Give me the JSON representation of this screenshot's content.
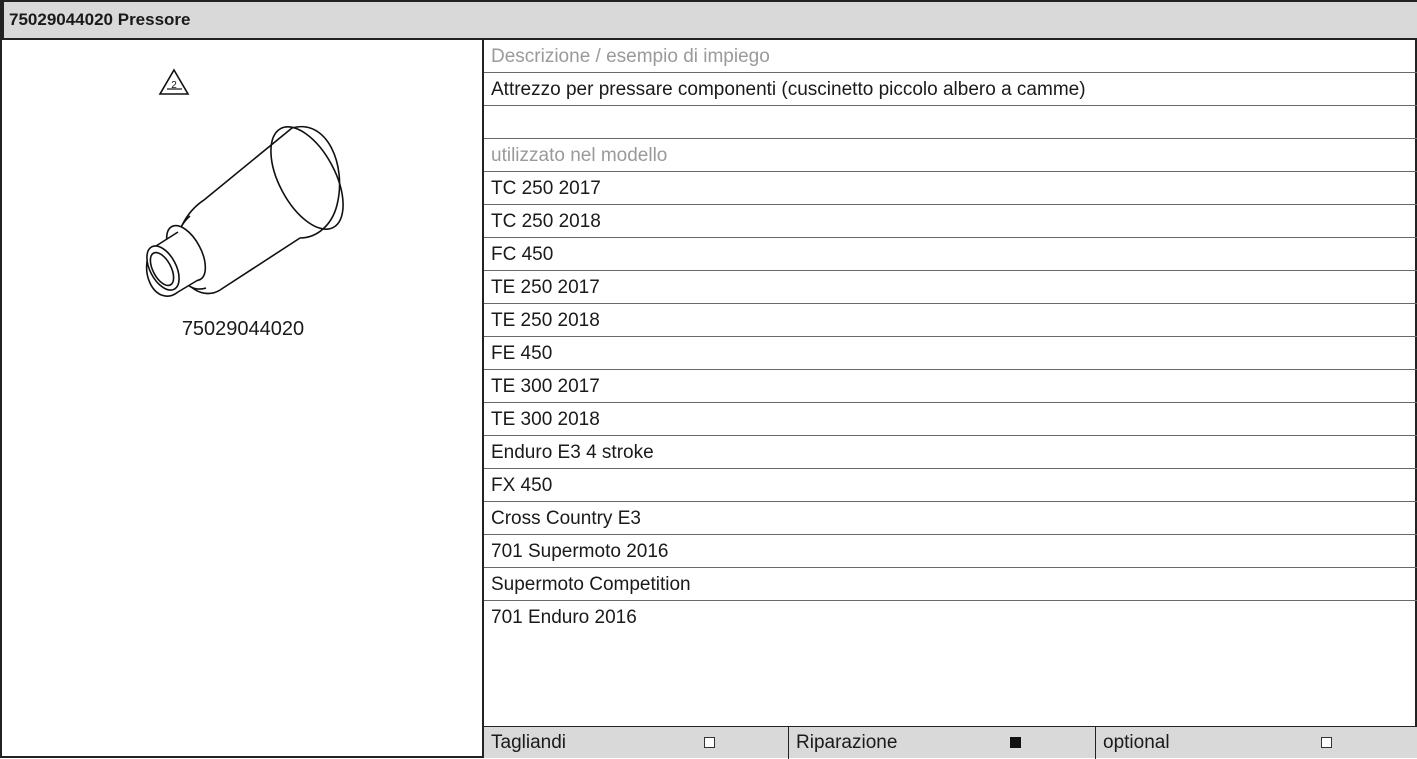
{
  "header": {
    "title": "75029044020 Pressore"
  },
  "tool": {
    "part_number": "75029044020",
    "warning_number": "2"
  },
  "description": {
    "label": "Descrizione / esempio di impiego",
    "text": "Attrezzo per pressare componenti (cuscinetto piccolo albero a camme)"
  },
  "models": {
    "label": "utilizzato nel modello",
    "items": [
      "TC 250 2017",
      "TC 250 2018",
      "FC 450",
      "TE 250 2017",
      "TE 250 2018",
      "FE 450",
      "TE 300 2017",
      "TE 300 2018",
      "Enduro E3 4 stroke",
      "FX 450",
      "Cross Country E3",
      "701 Supermoto 2016",
      "Supermoto Competition",
      "701 Enduro 2016"
    ]
  },
  "categories": [
    {
      "label": "Tagliandi",
      "checked": false
    },
    {
      "label": "Riparazione",
      "checked": true
    },
    {
      "label": "optional",
      "checked": false
    }
  ]
}
